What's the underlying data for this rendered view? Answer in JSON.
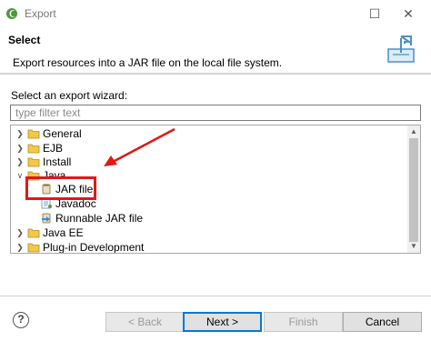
{
  "window": {
    "title": "Export",
    "maximize_icon": "maximize-icon",
    "close_icon": "close-icon"
  },
  "header": {
    "title": "Select",
    "description": "Export resources into a JAR file on the local file system.",
    "graphic_icon": "export-wizard-icon"
  },
  "wizard": {
    "label": "Select an export wizard:",
    "filter_placeholder": "type filter text",
    "filter_value": ""
  },
  "tree": {
    "items": [
      {
        "label": "General",
        "expanded": false,
        "level": 0,
        "icon": "folder-icon"
      },
      {
        "label": "EJB",
        "expanded": false,
        "level": 0,
        "icon": "folder-icon"
      },
      {
        "label": "Install",
        "expanded": false,
        "level": 0,
        "icon": "folder-icon"
      },
      {
        "label": "Java",
        "expanded": true,
        "level": 0,
        "icon": "folder-icon"
      },
      {
        "label": "JAR file",
        "level": 1,
        "icon": "jar-file-icon",
        "selected": true
      },
      {
        "label": "Javadoc",
        "level": 1,
        "icon": "javadoc-icon"
      },
      {
        "label": "Runnable JAR file",
        "level": 1,
        "icon": "runnable-jar-icon"
      },
      {
        "label": "Java EE",
        "expanded": false,
        "level": 0,
        "icon": "folder-icon"
      },
      {
        "label": "Plug-in Development",
        "expanded": false,
        "level": 0,
        "icon": "folder-icon"
      }
    ]
  },
  "buttons": {
    "help": "?",
    "back": "< Back",
    "next": "Next >",
    "finish": "Finish",
    "cancel": "Cancel"
  },
  "colors": {
    "annotation_red": "#e01818",
    "default_button_border": "#0078d7"
  }
}
